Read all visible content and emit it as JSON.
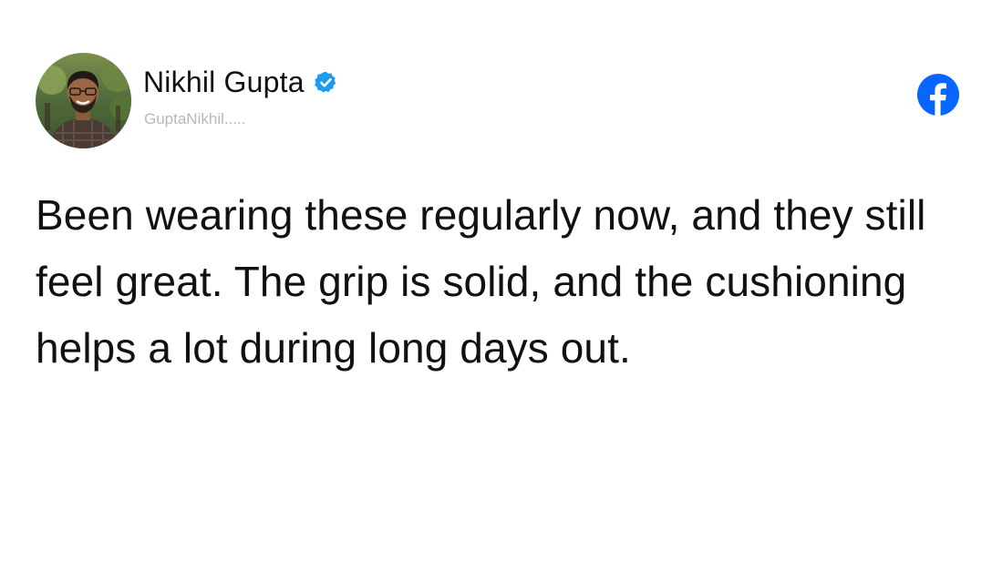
{
  "post": {
    "author": {
      "name": "Nikhil Gupta",
      "handle": "GuptaNikhil.....",
      "verified": true,
      "avatar": "profile-photo"
    },
    "text": "Been wearing these regularly now, and they still feel great. The grip is solid, and the cushioning helps a lot during long days out.",
    "platform_icon": "facebook-icon"
  },
  "colors": {
    "verified_blue": "#1d9bf0",
    "facebook_blue": "#0866ff",
    "handle_gray": "#b8b8b8",
    "text": "#111111"
  }
}
